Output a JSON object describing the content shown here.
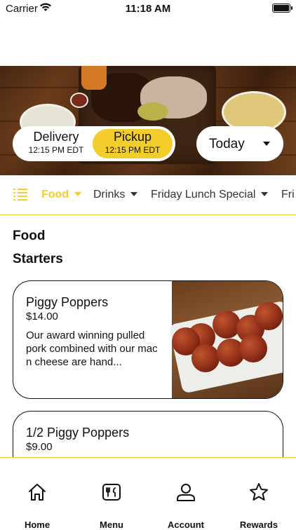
{
  "status_bar": {
    "carrier": "Carrier",
    "time": "11:18 AM"
  },
  "order_mode": {
    "delivery": {
      "label": "Delivery",
      "time": "12:15 PM EDT"
    },
    "pickup": {
      "label": "Pickup",
      "time": "12:15 PM EDT"
    },
    "selected": "pickup"
  },
  "day_select": {
    "value": "Today"
  },
  "categories": [
    {
      "label": "Food",
      "active": true
    },
    {
      "label": "Drinks",
      "active": false
    },
    {
      "label": "Friday Lunch Special",
      "active": false
    },
    {
      "label": "Fri",
      "active": false
    }
  ],
  "menu": {
    "section_title": "Food",
    "subsection_title": "Starters",
    "items": [
      {
        "name": "Piggy Poppers",
        "price": "$14.00",
        "description": "Our award winning pulled pork combined with our mac n cheese are hand..."
      },
      {
        "name": "1/2 Piggy Poppers",
        "price": "$9.00",
        "description": ""
      }
    ]
  },
  "tabs": [
    {
      "label": "Home",
      "icon": "home-icon"
    },
    {
      "label": "Menu",
      "icon": "menu-icon"
    },
    {
      "label": "Account",
      "icon": "account-icon"
    },
    {
      "label": "Rewards",
      "icon": "star-icon"
    }
  ],
  "colors": {
    "accent": "#f2cd2b",
    "text": "#111111",
    "background": "#ffffff"
  }
}
